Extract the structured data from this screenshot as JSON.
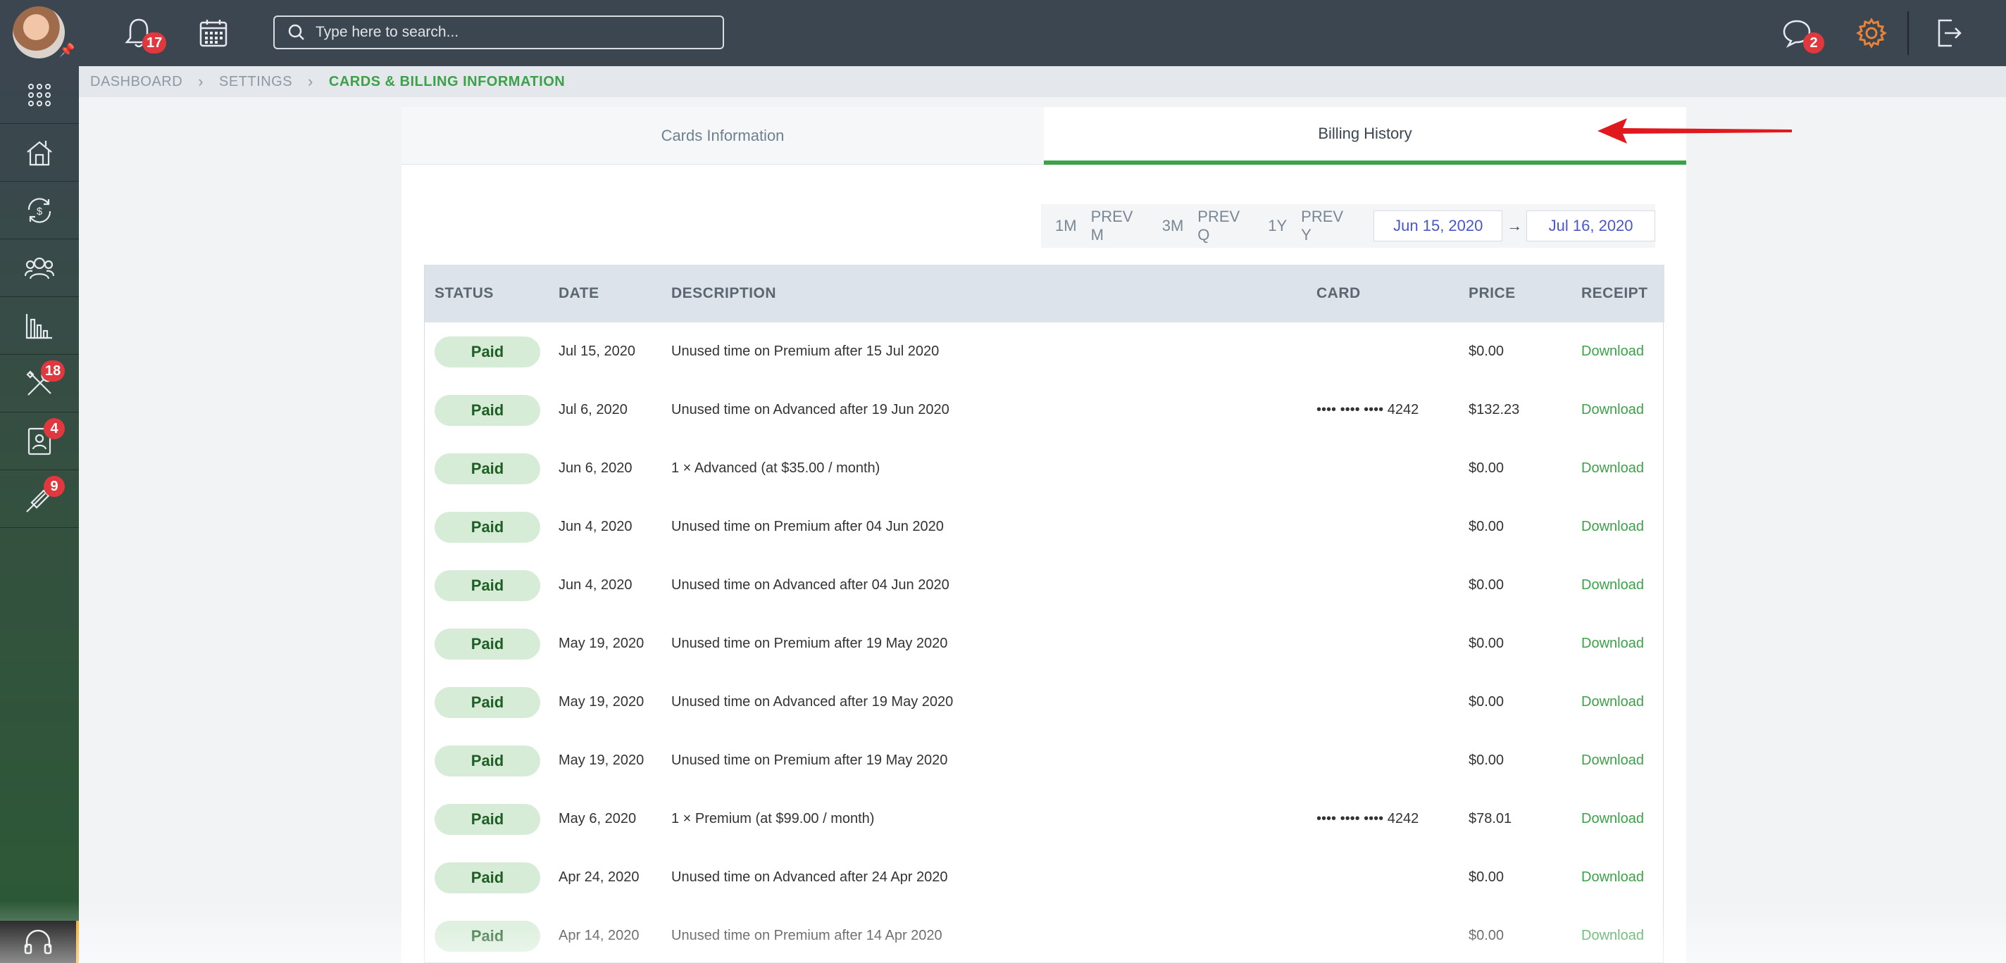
{
  "header": {
    "notifications_count": "17",
    "search_placeholder": "Type here to search...",
    "messages_count": "2"
  },
  "sidebar": {
    "items": [
      {
        "icon": "apps-grid-icon",
        "badge": ""
      },
      {
        "icon": "house-icon",
        "badge": ""
      },
      {
        "icon": "money-exchange-icon",
        "badge": ""
      },
      {
        "icon": "users-icon",
        "badge": ""
      },
      {
        "icon": "bar-chart-icon",
        "badge": ""
      },
      {
        "icon": "tools-icon",
        "badge": "18"
      },
      {
        "icon": "contact-card-icon",
        "badge": "4"
      },
      {
        "icon": "syringe-icon",
        "badge": "9"
      }
    ]
  },
  "breadcrumb": {
    "items": [
      "DASHBOARD",
      "SETTINGS",
      "CARDS & BILLING INFORMATION"
    ]
  },
  "tabs": [
    "Cards Information",
    "Billing History"
  ],
  "filters": {
    "ranges": [
      "1M",
      "PREV M",
      "3M",
      "PREV Q",
      "1Y",
      "PREV Y"
    ],
    "start_date": "Jun 15, 2020",
    "end_date": "Jul 16, 2020"
  },
  "table": {
    "headers": [
      "STATUS",
      "DATE",
      "DESCRIPTION",
      "CARD",
      "PRICE",
      "RECEIPT"
    ],
    "rows": [
      {
        "status": "Paid",
        "date": "Jul 15, 2020",
        "description": "Unused time on Premium after 15 Jul 2020",
        "card": "",
        "price": "$0.00",
        "receipt": "Download"
      },
      {
        "status": "Paid",
        "date": "Jul 6, 2020",
        "description": "Unused time on Advanced after 19 Jun 2020",
        "card": "•••• •••• •••• 4242",
        "price": "$132.23",
        "receipt": "Download"
      },
      {
        "status": "Paid",
        "date": "Jun 6, 2020",
        "description": "1 × Advanced (at $35.00 / month)",
        "card": "",
        "price": "$0.00",
        "receipt": "Download"
      },
      {
        "status": "Paid",
        "date": "Jun 4, 2020",
        "description": "Unused time on Premium after 04 Jun 2020",
        "card": "",
        "price": "$0.00",
        "receipt": "Download"
      },
      {
        "status": "Paid",
        "date": "Jun 4, 2020",
        "description": "Unused time on Advanced after 04 Jun 2020",
        "card": "",
        "price": "$0.00",
        "receipt": "Download"
      },
      {
        "status": "Paid",
        "date": "May 19, 2020",
        "description": "Unused time on Premium after 19 May 2020",
        "card": "",
        "price": "$0.00",
        "receipt": "Download"
      },
      {
        "status": "Paid",
        "date": "May 19, 2020",
        "description": "Unused time on Advanced after 19 May 2020",
        "card": "",
        "price": "$0.00",
        "receipt": "Download"
      },
      {
        "status": "Paid",
        "date": "May 19, 2020",
        "description": "Unused time on Premium after 19 May 2020",
        "card": "",
        "price": "$0.00",
        "receipt": "Download"
      },
      {
        "status": "Paid",
        "date": "May 6, 2020",
        "description": "1 × Premium (at $99.00 / month)",
        "card": "•••• •••• •••• 4242",
        "price": "$78.01",
        "receipt": "Download"
      },
      {
        "status": "Paid",
        "date": "Apr 24, 2020",
        "description": "Unused time on Advanced after 24 Apr 2020",
        "card": "",
        "price": "$0.00",
        "receipt": "Download"
      },
      {
        "status": "Paid",
        "date": "Apr 14, 2020",
        "description": "Unused time on Premium after 14 Apr 2020",
        "card": "",
        "price": "$0.00",
        "receipt": "Download"
      }
    ]
  },
  "colors": {
    "accent_green": "#3ca148",
    "date_blue": "#4a57c8",
    "badge_red": "#e0383e",
    "arrow_red": "#e0191f",
    "topbar": "#3b4650"
  }
}
